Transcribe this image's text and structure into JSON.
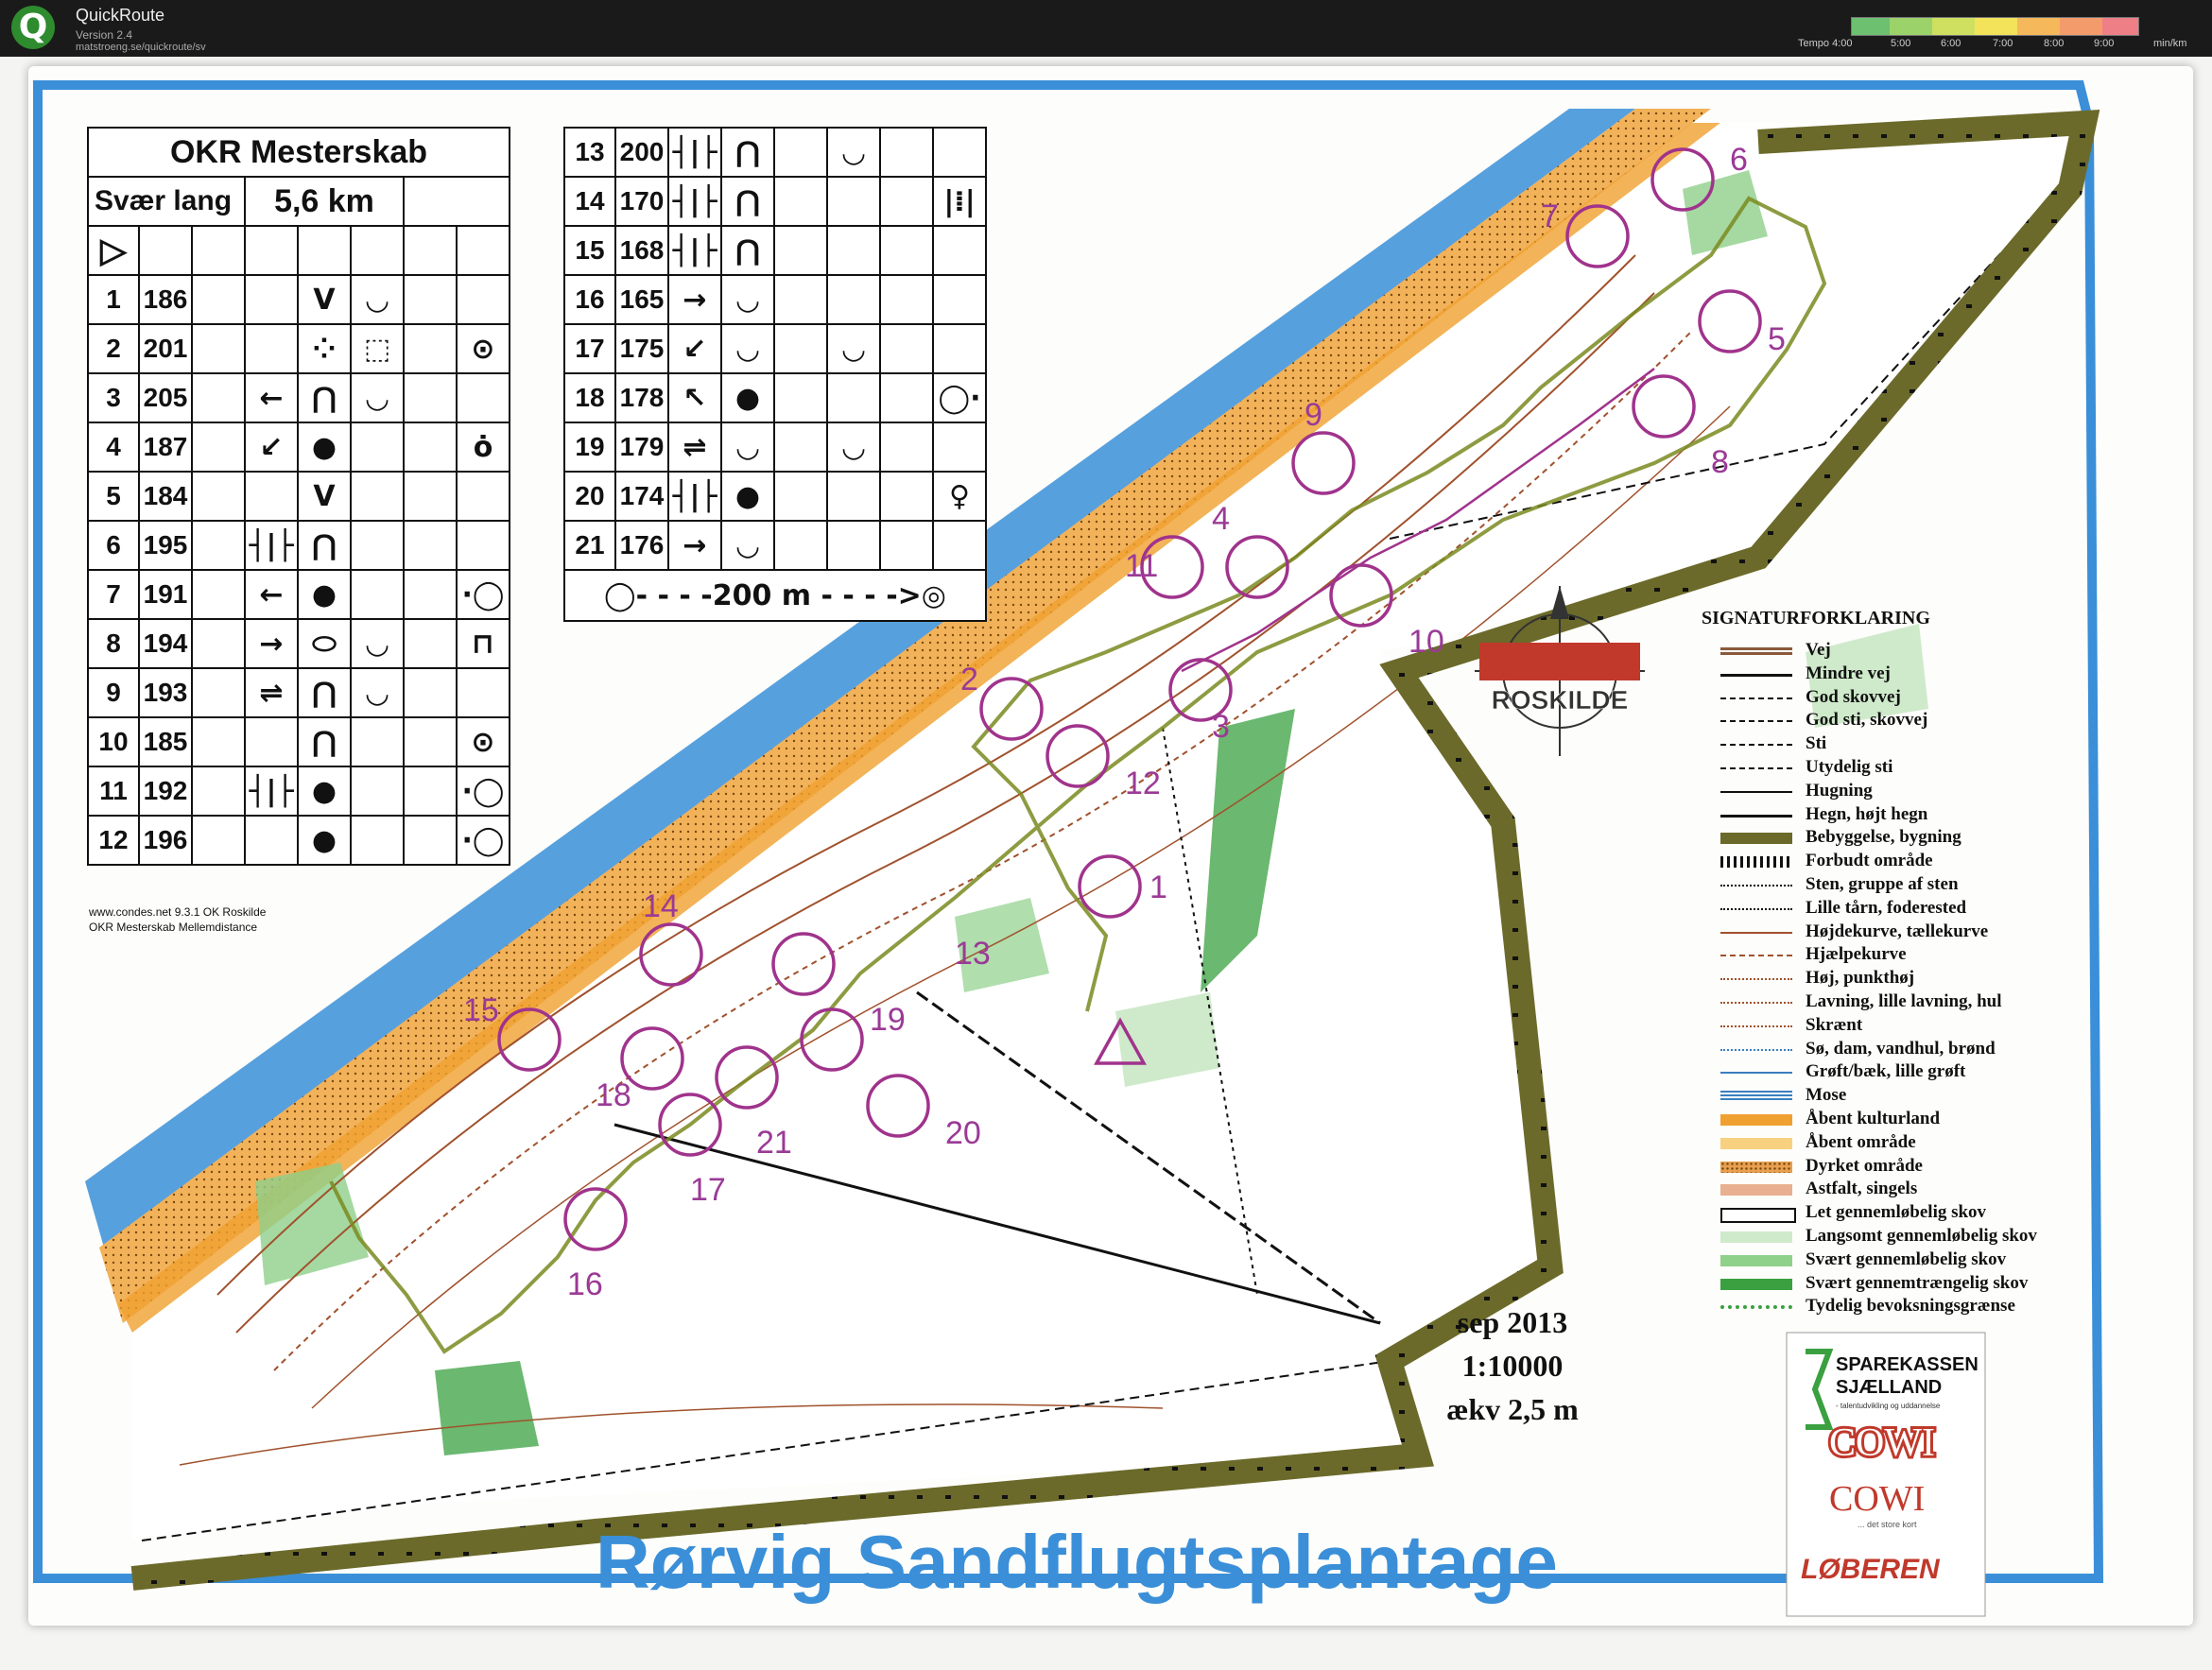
{
  "app": {
    "title": "QuickRoute",
    "version": "Version 2.4",
    "url": "matstroeng.se/quickroute/sv",
    "tempo_label": "Tempo 4:00",
    "tempo_ticks": [
      "5:00",
      "6:00",
      "7:00",
      "8:00",
      "9:00"
    ],
    "tempo_unit": "min/km"
  },
  "control_card": {
    "title": "OKR Mesterskab",
    "class": "Svær lang",
    "length": "5,6 km",
    "start_symbol": "▷",
    "controls": [
      {
        "n": "1",
        "code": "186",
        "c": "",
        "d": "",
        "e": "V",
        "f": "◡",
        "h": ""
      },
      {
        "n": "2",
        "code": "201",
        "c": "",
        "d": "",
        "e": "⁘",
        "f": "⬚",
        "h": "⊙"
      },
      {
        "n": "3",
        "code": "205",
        "c": "",
        "d": "←",
        "e": "⋂",
        "f": "◡",
        "h": ""
      },
      {
        "n": "4",
        "code": "187",
        "c": "",
        "d": "↙",
        "e": "●",
        "f": "",
        "h": "ȯ"
      },
      {
        "n": "5",
        "code": "184",
        "c": "",
        "d": "",
        "e": "V",
        "f": "",
        "h": ""
      },
      {
        "n": "6",
        "code": "195",
        "c": "",
        "d": "┤|├",
        "e": "⋂",
        "f": "",
        "h": ""
      },
      {
        "n": "7",
        "code": "191",
        "c": "",
        "d": "←",
        "e": "●",
        "f": "",
        "h": "·◯"
      },
      {
        "n": "8",
        "code": "194",
        "c": "",
        "d": "→",
        "e": "⬭",
        "f": "◡",
        "h": "⊓"
      },
      {
        "n": "9",
        "code": "193",
        "c": "",
        "d": "⇌",
        "e": "⋂",
        "f": "◡",
        "h": ""
      },
      {
        "n": "10",
        "code": "185",
        "c": "",
        "d": "",
        "e": "⋂",
        "f": "",
        "h": "⊙"
      },
      {
        "n": "11",
        "code": "192",
        "c": "",
        "d": "┤|├",
        "e": "●",
        "f": "",
        "h": "·◯"
      },
      {
        "n": "12",
        "code": "196",
        "c": "",
        "d": "",
        "e": "●",
        "f": "",
        "h": "·◯"
      }
    ],
    "controls_right": [
      {
        "n": "13",
        "code": "200",
        "d": "┤|├",
        "e": "⋂",
        "f": "",
        "g": "◡",
        "h": ""
      },
      {
        "n": "14",
        "code": "170",
        "d": "┤|├",
        "e": "⋂",
        "f": "",
        "g": "",
        "h": "|⁞|"
      },
      {
        "n": "15",
        "code": "168",
        "d": "┤|├",
        "e": "⋂",
        "f": "",
        "g": "",
        "h": ""
      },
      {
        "n": "16",
        "code": "165",
        "d": "→",
        "e": "◡",
        "f": "",
        "g": "",
        "h": ""
      },
      {
        "n": "17",
        "code": "175",
        "d": "↙",
        "e": "◡",
        "f": "",
        "g": "◡",
        "h": ""
      },
      {
        "n": "18",
        "code": "178",
        "d": "↖",
        "e": "●",
        "f": "",
        "g": "",
        "h": "◯·"
      },
      {
        "n": "19",
        "code": "179",
        "d": "⇌",
        "e": "◡",
        "f": "",
        "g": "◡",
        "h": ""
      },
      {
        "n": "20",
        "code": "174",
        "d": "┤|├",
        "e": "●",
        "f": "",
        "g": "",
        "h": "♀"
      },
      {
        "n": "21",
        "code": "176",
        "d": "→",
        "e": "◡",
        "f": "",
        "g": "",
        "h": ""
      }
    ],
    "finish_row": "◯- - - -200 m - - - ->◎",
    "footer_1": "www.condes.net 9.3.1 OK Roskilde",
    "footer_2": "OKR Mesterskab Mellemdistance"
  },
  "legend": {
    "title": "SIGNATURFORKLARING",
    "items": [
      {
        "label": "Vej",
        "color": "#8a5a3a",
        "style": "double"
      },
      {
        "label": "Mindre vej",
        "color": "#111111",
        "style": "solid"
      },
      {
        "label": "God skovvej",
        "color": "#111111",
        "style": "longdash"
      },
      {
        "label": "God sti, skovvej",
        "color": "#111111",
        "style": "dash"
      },
      {
        "label": "Sti",
        "color": "#111111",
        "style": "shortdash"
      },
      {
        "label": "Utydelig sti",
        "color": "#111111",
        "style": "dotdash"
      },
      {
        "label": "Hugning",
        "color": "#111111",
        "style": "thin"
      },
      {
        "label": "Hegn, højt hegn",
        "color": "#111111",
        "style": "fence"
      },
      {
        "label": "Bebyggelse, bygning",
        "color": "#6b6a2a",
        "style": "block"
      },
      {
        "label": "Forbudt område",
        "color": "#111111",
        "style": "hatch"
      },
      {
        "label": "Sten, gruppe af sten",
        "color": "#111111",
        "style": "dots"
      },
      {
        "label": "Lille tårn, foderested",
        "color": "#111111",
        "style": "tower"
      },
      {
        "label": "Højdekurve, tællekurve",
        "color": "#a0522d",
        "style": "contour"
      },
      {
        "label": "Hjælpekurve",
        "color": "#a0522d",
        "style": "dashcontour"
      },
      {
        "label": "Høj, punkthøj",
        "color": "#a0522d",
        "style": "knoll"
      },
      {
        "label": "Lavning, lille lavning, hul",
        "color": "#a0522d",
        "style": "depression"
      },
      {
        "label": "Skrænt",
        "color": "#a0522d",
        "style": "cliff"
      },
      {
        "label": "Sø, dam, vandhul, brønd",
        "color": "#3a7fc0",
        "style": "water"
      },
      {
        "label": "Grøft/bæk, lille grøft",
        "color": "#3a7fc0",
        "style": "stream"
      },
      {
        "label": "Mose",
        "color": "#3a7fc0",
        "style": "marsh"
      },
      {
        "label": "Åbent kulturland",
        "color": "#f0a030",
        "style": "fill"
      },
      {
        "label": "Åbent område",
        "color": "#f7d080",
        "style": "fill"
      },
      {
        "label": "Dyrket område",
        "color": "#e8a050",
        "style": "dotfill"
      },
      {
        "label": "Astfalt, singels",
        "color": "#e8b090",
        "style": "fill"
      },
      {
        "label": "Let gennemløbelig skov",
        "color": "#ffffff",
        "style": "box"
      },
      {
        "label": "Langsomt gennemløbelig skov",
        "color": "#cfeacb",
        "style": "fill"
      },
      {
        "label": "Svært gennemløbelig skov",
        "color": "#8fd08a",
        "style": "fill"
      },
      {
        "label": "Svært gennemtrængelig skov",
        "color": "#3aa040",
        "style": "fill"
      },
      {
        "label": "Tydelig bevoksningsgrænse",
        "color": "#3aa040",
        "style": "greendots"
      }
    ]
  },
  "map": {
    "club_logo": "ROSKILDE",
    "date": "sep 2013",
    "scale": "1:10000",
    "equidistance": "ækv 2,5 m",
    "title_partial": "Rørvig Sandflugtsplantage",
    "control_labels": [
      "1",
      "2",
      "3",
      "4",
      "5",
      "6",
      "7",
      "8",
      "9",
      "10",
      "11",
      "12",
      "13",
      "14",
      "15",
      "16",
      "17",
      "18",
      "19",
      "20",
      "21"
    ],
    "sponsors": [
      "SPAREKASSEN",
      "SJÆLLAND",
      "COWI",
      "COWI",
      "LØBEREN"
    ],
    "sponsor_tagline": "- talentudvikling og uddannelse",
    "sponsor_tagline2": "... det store kort"
  },
  "colors": {
    "sea": "#3a8fd8",
    "beach": "#f2a440",
    "forest_light": "#cfeacb",
    "forest": "#8fd08a",
    "forest_dark": "#3aa040",
    "boundary": "#6b6a2a",
    "course": "#a0338c",
    "route": "#7a8a20",
    "contour": "#a0522d"
  }
}
